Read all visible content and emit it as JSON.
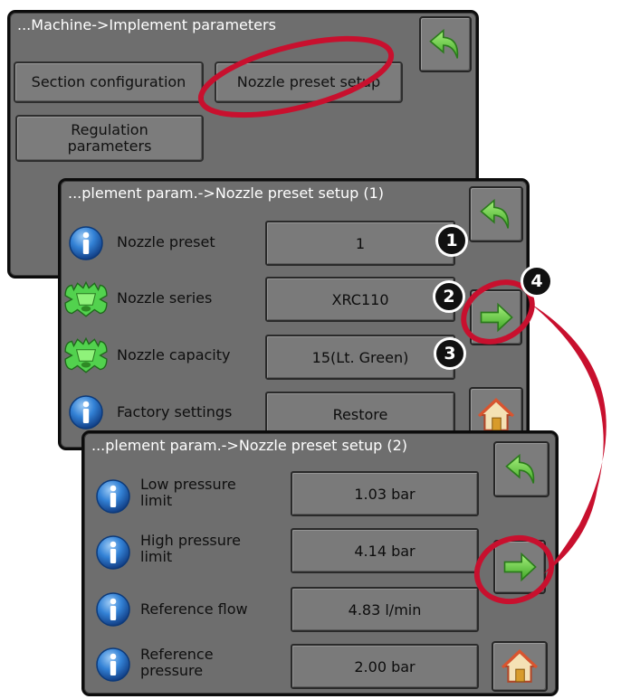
{
  "panel1": {
    "title": "...Machine->Implement parameters",
    "buttons": {
      "section_configuration": "Section configuration",
      "nozzle_preset_setup": "Nozzle preset setup",
      "regulation_parameters": "Regulation parameters"
    }
  },
  "panel2": {
    "title": "...plement param.->Nozzle preset setup (1)",
    "rows": [
      {
        "label": "Nozzle preset",
        "value": "1",
        "icon": "info-icon"
      },
      {
        "label": "Nozzle series",
        "value": "XRC110",
        "icon": "nozzle-icon"
      },
      {
        "label": "Nozzle capacity",
        "value": "15(Lt. Green)",
        "icon": "nozzle-icon"
      },
      {
        "label": "Factory settings",
        "value": "Restore",
        "icon": "info-icon"
      }
    ]
  },
  "panel3": {
    "title": "...plement param.->Nozzle preset setup (2)",
    "rows": [
      {
        "label": "Low pressure limit",
        "value": "1.03 bar",
        "icon": "info-icon"
      },
      {
        "label": "High pressure limit",
        "value": "4.14 bar",
        "icon": "info-icon"
      },
      {
        "label": "Reference flow",
        "value": "4.83 l/min",
        "icon": "info-icon"
      },
      {
        "label": "Reference pressure",
        "value": "2.00 bar",
        "icon": "info-icon"
      }
    ]
  },
  "callouts": [
    "1",
    "2",
    "3",
    "4"
  ],
  "colors": {
    "panel_bg": "#6e6e6e",
    "button_bg": "#7c7c7c",
    "annotation_red": "#c8102e",
    "info_blue": "#1d63b4",
    "nozzle_green": "#4fd34b",
    "arrow_green": "#6fd14a"
  }
}
